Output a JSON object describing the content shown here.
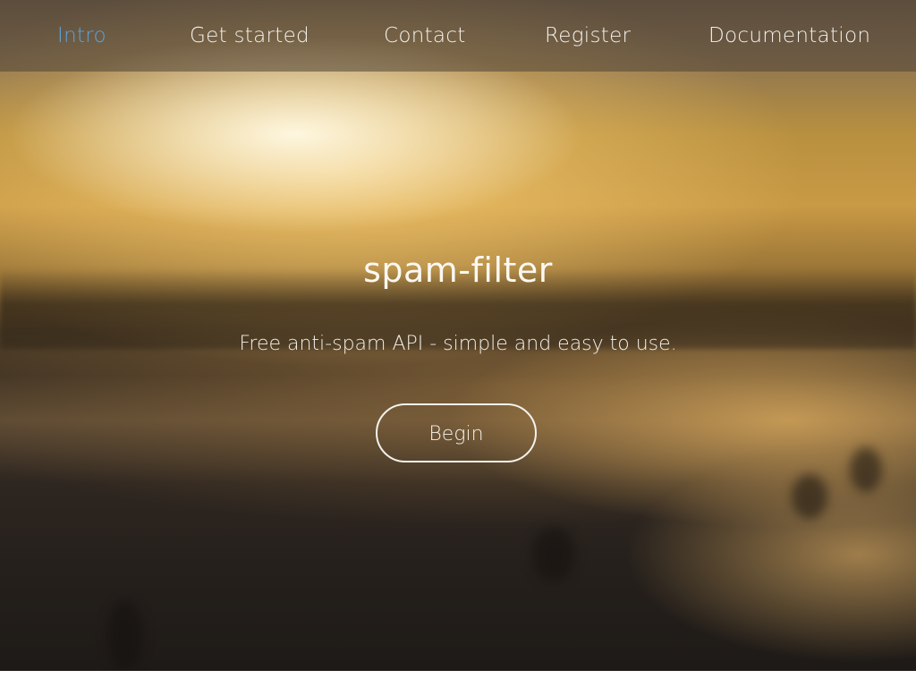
{
  "nav": {
    "items": [
      {
        "label": "Intro",
        "active": true
      },
      {
        "label": "Get started",
        "active": false
      },
      {
        "label": "Contact",
        "active": false
      },
      {
        "label": "Register",
        "active": false
      },
      {
        "label": "Documentation",
        "active": false
      }
    ],
    "active_color": "#5da2d8",
    "text_color": "#f4f1ec"
  },
  "hero": {
    "title": "spam-filter",
    "subtitle": "Free anti-spam API - simple and easy to use.",
    "cta_label": "Begin",
    "background": "blurred sunset beach photo"
  }
}
